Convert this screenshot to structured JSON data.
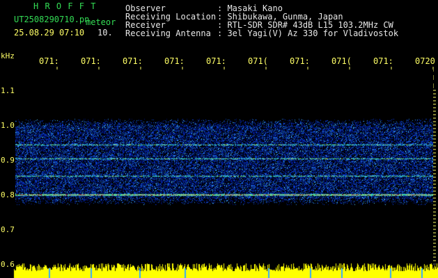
{
  "header": {
    "title": "H R O F F T",
    "filename": "UT2508290710.pn",
    "filename_suffix": "meteor",
    "timestamp": "25.08.29 07:10",
    "interval": "10.",
    "info": [
      {
        "label": "Observer",
        "value": ": Masaki Kano"
      },
      {
        "label": "Receiving Location",
        "value": ": Shibukawa, Gunma, Japan"
      },
      {
        "label": "Receiver",
        "value": ": RTL-SDR SDR# 43dB L15 103.2MHz CW"
      },
      {
        "label": "Receiving Antenna",
        "value": ": 3el Yagi(V) Az 330 for Vladivostok"
      }
    ]
  },
  "time_axis": {
    "labels": [
      "071:",
      "071:",
      "071:",
      "071:",
      "071:",
      "071(",
      "071:",
      "071(",
      "071:",
      "0720"
    ]
  },
  "freq_axis": {
    "unit": "kHz",
    "labels": [
      "1.1",
      "1.0",
      "0.9",
      "0.8",
      "0.7",
      "0.6"
    ]
  },
  "spectrogram": {
    "background_color": "#000000",
    "band_top_khz": 1.02,
    "band_bottom_khz": 0.77,
    "carrier_lines_khz": [
      0.945,
      0.905,
      0.855,
      0.8
    ],
    "strongest_line_khz": 0.8
  },
  "colors": {
    "title": "#33dd55",
    "timestamp": "#ffff66",
    "info_text": "#e8e8e8",
    "axis_text": "#ffff66",
    "signal_strip": "#ffff00",
    "marker_ticks": "#33aaff"
  }
}
